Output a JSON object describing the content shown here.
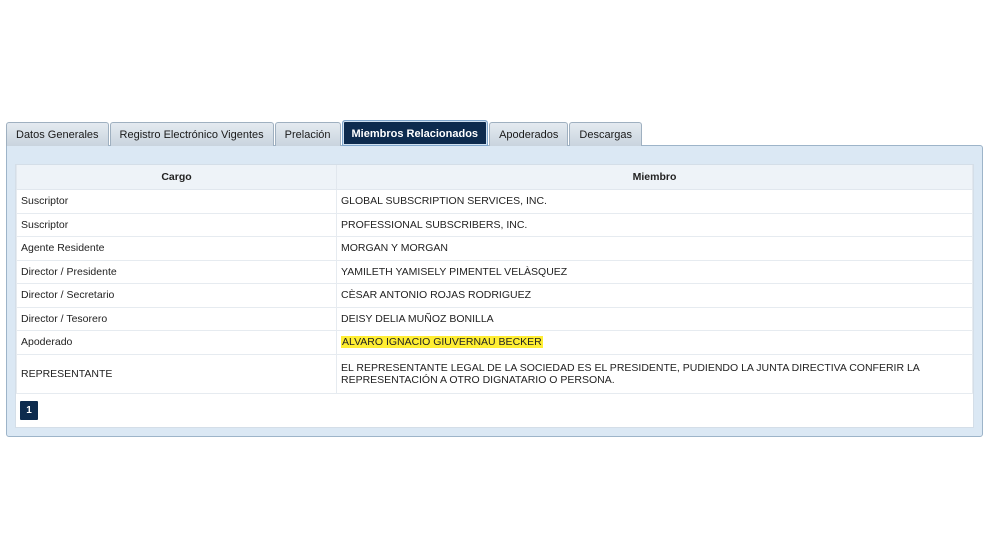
{
  "tabs": [
    {
      "label": "Datos Generales",
      "active": false
    },
    {
      "label": "Registro Electrónico Vigentes",
      "active": false
    },
    {
      "label": "Prelación",
      "active": false
    },
    {
      "label": "Miembros Relacionados",
      "active": true
    },
    {
      "label": "Apoderados",
      "active": false
    },
    {
      "label": "Descargas",
      "active": false
    }
  ],
  "table": {
    "headers": [
      "Cargo",
      "Miembro"
    ],
    "rows": [
      {
        "cargo": "Suscriptor",
        "miembro": "GLOBAL SUBSCRIPTION SERVICES, INC."
      },
      {
        "cargo": "Suscriptor",
        "miembro": "PROFESSIONAL SUBSCRIBERS, INC."
      },
      {
        "cargo": "Agente Residente",
        "miembro": "MORGAN Y MORGAN"
      },
      {
        "cargo": "Director / Presidente",
        "miembro": "YAMILETH YAMISELY PIMENTEL VELÀSQUEZ"
      },
      {
        "cargo": "Director / Secretario",
        "miembro": "CÈSAR ANTONIO ROJAS RODRIGUEZ"
      },
      {
        "cargo": "Director / Tesorero",
        "miembro": "DEISY DELIA MUÑOZ BONILLA"
      },
      {
        "cargo": "Apoderado",
        "miembro": "ALVARO IGNACIO GIUVERNAU BECKER",
        "highlighted": true
      },
      {
        "cargo": "REPRESENTANTE",
        "miembro": "EL REPRESENTANTE LEGAL DE LA SOCIEDAD ES EL PRESIDENTE, PUDIENDO LA JUNTA DIRECTIVA CONFERIR LA REPRESENTACIÓN A OTRO DIGNATARIO O PERSONA."
      }
    ]
  },
  "pagination": {
    "current": "1"
  },
  "colors": {
    "active_tab": "#0d2b4e",
    "panel_bg": "#dbe8f4",
    "highlight": "#ffee33"
  }
}
